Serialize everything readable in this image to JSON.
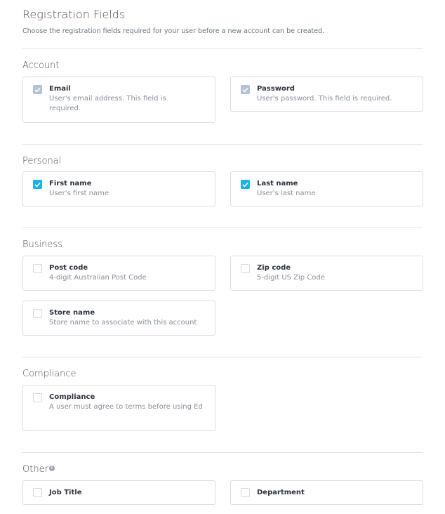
{
  "header": {
    "title": "Registration Fields",
    "subtitle": "Choose the registration fields required for your user before a new account can be created."
  },
  "colors": {
    "checked": "#1ab0ee",
    "disabled_checked": "#b5c2d6",
    "border": "#d9dde5"
  },
  "sections": {
    "account": {
      "title": "Account",
      "fields": [
        {
          "label": "Email",
          "description": "User's email address. This field is required.",
          "state": "checked-disabled"
        },
        {
          "label": "Password",
          "description": "User's password. This field is required.",
          "state": "checked-disabled"
        }
      ]
    },
    "personal": {
      "title": "Personal",
      "fields": [
        {
          "label": "First name",
          "description": "User's first name",
          "state": "checked"
        },
        {
          "label": "Last name",
          "description": "User's last name",
          "state": "checked"
        }
      ]
    },
    "business": {
      "title": "Business",
      "fields": [
        {
          "label": "Post code",
          "description": "4-digit Australian Post Code",
          "state": "unchecked"
        },
        {
          "label": "Zip code",
          "description": "5-digit US Zip Code",
          "state": "unchecked"
        },
        {
          "label": "Store name",
          "description": "Store name to associate with this account",
          "state": "unchecked"
        }
      ]
    },
    "compliance": {
      "title": "Compliance",
      "fields": [
        {
          "label": "Compliance",
          "description": "A user must agree to terms before using Ed",
          "state": "unchecked"
        }
      ]
    },
    "other": {
      "title": "Other",
      "info_icon": "info-icon",
      "fields": [
        {
          "label": "Job Title",
          "state": "unchecked"
        },
        {
          "label": "Department",
          "state": "unchecked"
        }
      ]
    }
  }
}
